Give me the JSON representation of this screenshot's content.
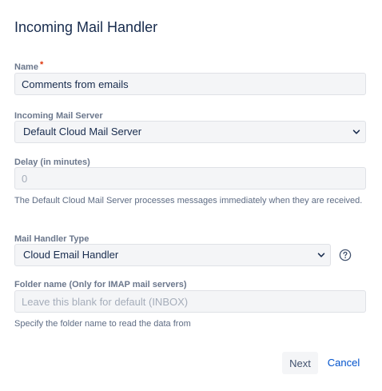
{
  "dialog": {
    "title": "Incoming Mail Handler"
  },
  "form": {
    "name": {
      "label": "Name",
      "required_marker": "*",
      "value": "Comments from emails"
    },
    "mail_server": {
      "label": "Incoming Mail Server",
      "selected": "Default Cloud Mail Server"
    },
    "delay": {
      "label": "Delay (in minutes)",
      "value": "0",
      "help": "The Default Cloud Mail Server processes messages immediately when they are received."
    },
    "handler_type": {
      "label": "Mail Handler Type",
      "selected": "Cloud Email Handler",
      "help_icon": "question-circle-icon"
    },
    "folder_name": {
      "label": "Folder name (Only for IMAP mail servers)",
      "placeholder": "Leave this blank for default (INBOX)",
      "value": "",
      "help": "Specify the folder name to read the data from"
    }
  },
  "actions": {
    "next_label": "Next",
    "cancel_label": "Cancel"
  },
  "colors": {
    "text": "#172b4d",
    "label": "#6b778c",
    "required": "#de350b",
    "field_bg": "#f4f5f7",
    "field_border": "#dfe1e6",
    "link": "#0052cc"
  }
}
